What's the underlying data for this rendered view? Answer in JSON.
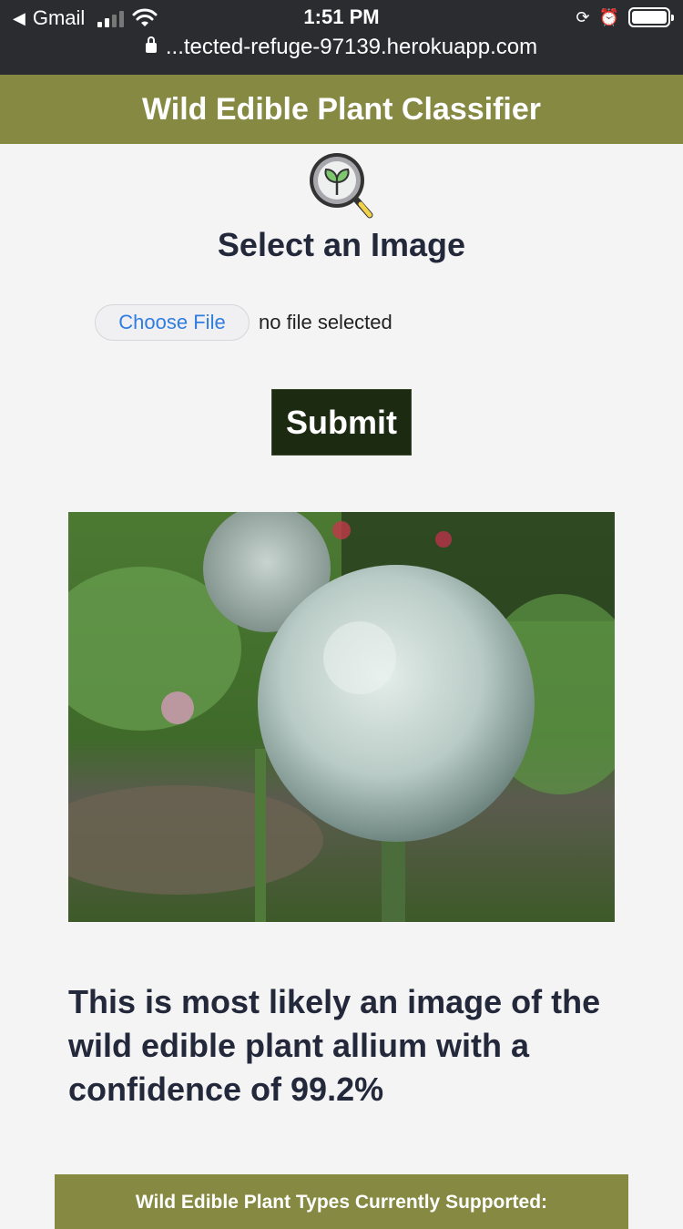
{
  "status_bar": {
    "back_app": "Gmail",
    "time": "1:51 PM",
    "url": "...tected-refuge-97139.herokuapp.com"
  },
  "header": {
    "title": "Wild Edible Plant Classifier"
  },
  "upload": {
    "title": "Select an Image",
    "choose_file_label": "Choose File",
    "file_status": "no file selected",
    "submit_label": "Submit"
  },
  "result": {
    "text": "This is most likely an image of the wild edible plant allium with a confidence of 99.2%"
  },
  "footer": {
    "supported_title": "Wild Edible Plant Types Currently Supported:"
  },
  "colors": {
    "header_bg": "#858941",
    "submit_bg": "#1b2a10",
    "text": "#23283a",
    "link": "#2f7de0"
  }
}
